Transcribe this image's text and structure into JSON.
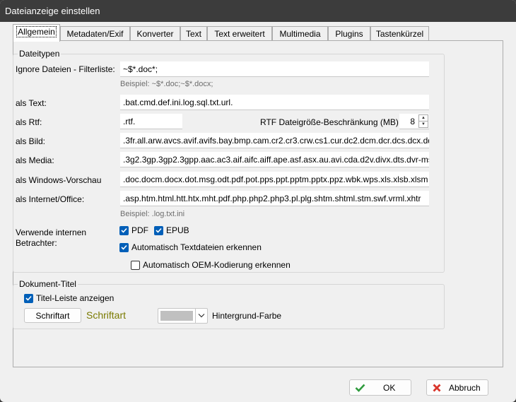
{
  "window": {
    "title": "Dateianzeige einstellen"
  },
  "tabs": [
    {
      "label": "Allgemein",
      "active": true
    },
    {
      "label": "Metadaten/Exif"
    },
    {
      "label": "Konverter"
    },
    {
      "label": "Text"
    },
    {
      "label": "Text erweitert"
    },
    {
      "label": "Multimedia"
    },
    {
      "label": "Plugins"
    },
    {
      "label": "Tastenkürzel"
    }
  ],
  "dateitypen": {
    "title": "Dateitypen",
    "ignore_label": "Ignore Dateien - Filterliste:",
    "ignore_value": "~$*.doc*;",
    "ignore_hint": "Beispiel: ~$*.doc;~$*.docx;",
    "text_label": "als Text:",
    "text_value": ".bat.cmd.def.ini.log.sql.txt.url.",
    "rtf_label": "als Rtf:",
    "rtf_value": ".rtf.",
    "rtf_limit_label": "RTF Dateigröße-Beschränkung (MB):",
    "rtf_limit_value": "8",
    "bild_label": "als Bild:",
    "bild_value": ".3fr.all.arw.avcs.avif.avifs.bay.bmp.cam.cr2.cr3.crw.cs1.cur.dc2.dcm.dcr.dcs.dcx.dd",
    "media_label": "als Media:",
    "media_value": ".3g2.3gp.3gp2.3gpp.aac.ac3.aif.aifc.aiff.ape.asf.asx.au.avi.cda.d2v.divx.dts.dvr-ms.f",
    "winvorschau_label": "als Windows-Vorschau",
    "winvorschau_value": ".doc.docm.docx.dot.msg.odt.pdf.pot.pps.ppt.pptm.pptx.ppz.wbk.wps.xls.xlsb.xlsm",
    "internet_label": "als Internet/Office:",
    "internet_value": ".asp.htm.html.htt.htx.mht.pdf.php.php2.php3.pl.plg.shtm.shtml.stm.swf.vrml.xhtr",
    "internet_hint": "Beispiel: .log.txt.ini",
    "betrachter_label_1": "Verwende internen",
    "betrachter_label_2": "Betrachter:",
    "pdf_label": "PDF",
    "epub_label": "EPUB",
    "auto_text_label": "Automatisch Textdateien erkennen",
    "auto_oem_label": "Automatisch OEM-Kodierung erkennen"
  },
  "dokument_titel": {
    "title": "Dokument-Titel",
    "titelleiste_label": "Titel-Leiste anzeigen",
    "schriftart_button": "Schriftart",
    "schriftart_preview": "Schriftart",
    "schriftart_preview_color": "#7a7a00",
    "hintergrund_label": "Hintergrund-Farbe",
    "hintergrund_color": "#c0c0c0"
  },
  "footer": {
    "ok_label": "OK",
    "cancel_label": "Abbruch"
  },
  "colors": {
    "accent": "#005fb8",
    "ok_green": "#2e9a3c",
    "cancel_red": "#d9352b"
  }
}
